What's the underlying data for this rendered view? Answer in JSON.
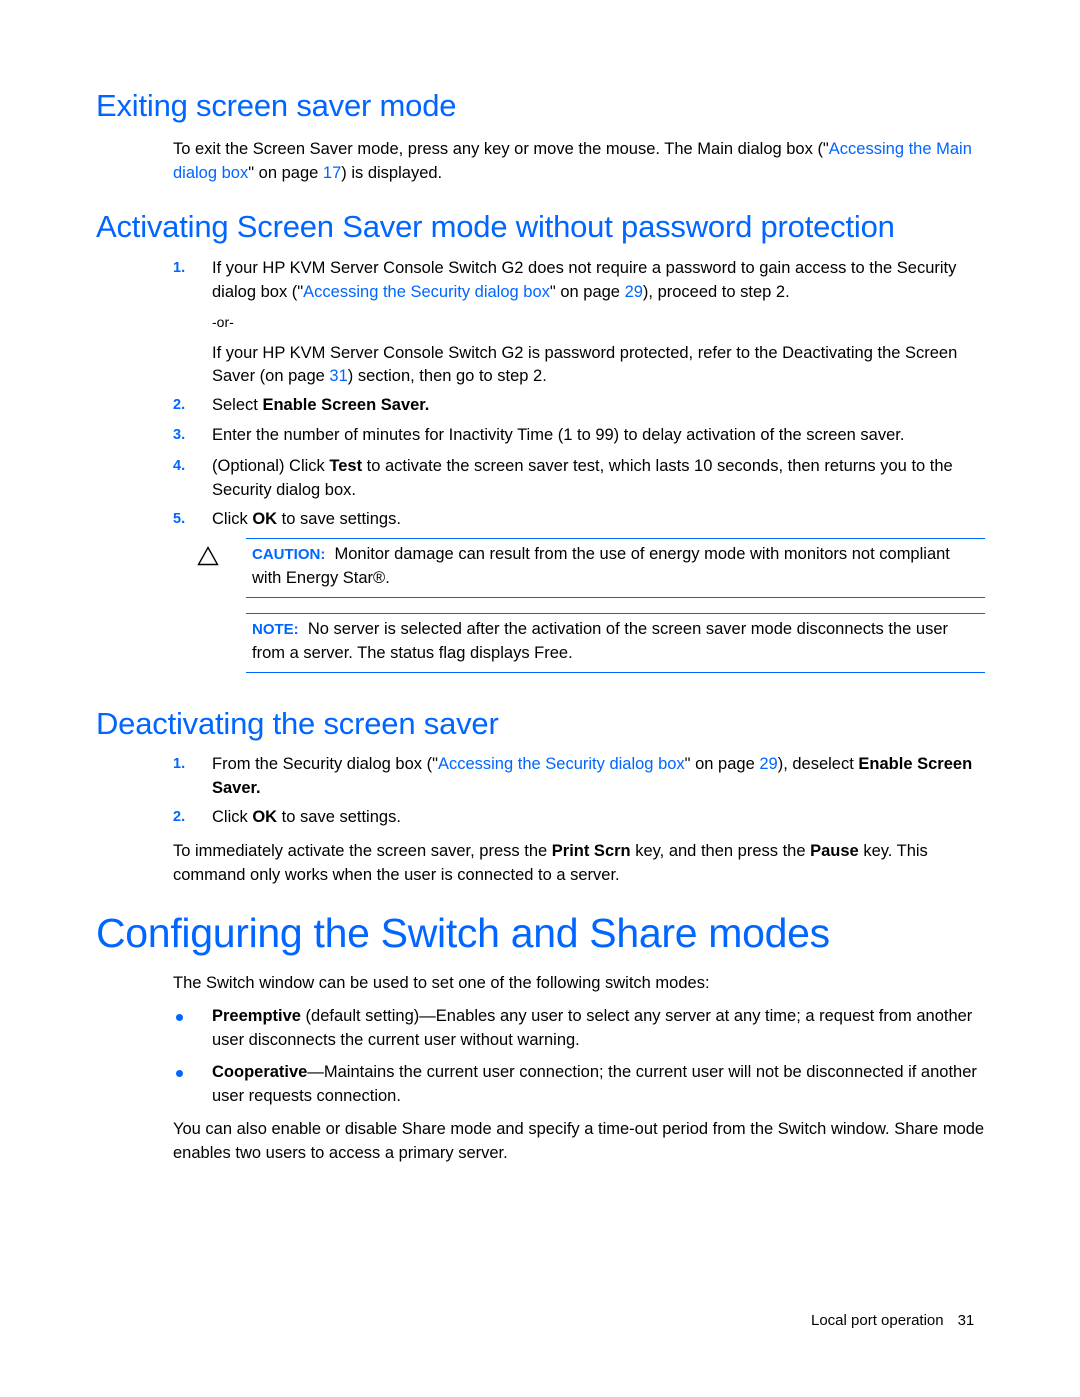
{
  "sections": {
    "exiting": {
      "heading": "Exiting screen saver mode",
      "para": {
        "t1": "To exit the Screen Saver mode, press any key or move the mouse. The Main dialog box (\"",
        "link1": "Accessing the Main dialog box",
        "t2": "\" on page ",
        "page": "17",
        "t3": ") is displayed."
      }
    },
    "activating": {
      "heading": "Activating Screen Saver mode without password protection",
      "steps": [
        {
          "num": "1.",
          "t1": "If your HP KVM Server Console Switch G2 does not require a password to gain access to the Security dialog box (\"",
          "link": "Accessing the Security dialog box",
          "t2": "\" on page ",
          "page": "29",
          "t3": "), proceed to step 2.",
          "or": "-or-",
          "alt_t1": "If your HP KVM Server Console Switch G2 is password protected, refer to the Deactivating the Screen Saver (on page ",
          "alt_page": "31",
          "alt_t2": ") section, then go to step 2."
        },
        {
          "num": "2.",
          "t1": "Select ",
          "bold": "Enable Screen Saver.",
          "t2": ""
        },
        {
          "num": "3.",
          "t1": "Enter the number of minutes for Inactivity Time (1 to 99) to delay activation of the screen saver."
        },
        {
          "num": "4.",
          "t1": "(Optional) Click ",
          "bold": "Test",
          "t2": " to activate the screen saver test, which lasts 10 seconds, then returns you to the Security dialog box."
        },
        {
          "num": "5.",
          "t1": "Click ",
          "bold": "OK",
          "t2": " to save settings."
        }
      ],
      "caution": {
        "label": "CAUTION:",
        "text": "Monitor damage can result from the use of energy mode with monitors not compliant with Energy Star®."
      },
      "note": {
        "label": "NOTE:",
        "text": "No server is selected after the activation of the screen saver mode disconnects the user from a server. The status flag displays Free."
      }
    },
    "deactivating": {
      "heading": "Deactivating the screen saver",
      "steps": [
        {
          "num": "1.",
          "t1": "From the Security dialog box (\"",
          "link": "Accessing the Security dialog box",
          "t2": "\" on page ",
          "page": "29",
          "t3": "), deselect ",
          "bold": "Enable Screen Saver."
        },
        {
          "num": "2.",
          "t1": "Click ",
          "bold": "OK",
          "t2": " to save settings."
        }
      ],
      "para": {
        "t1": "To immediately activate the screen saver, press the ",
        "b1": "Print Scrn",
        "t2": " key, and then press the ",
        "b2": "Pause",
        "t3": " key. This command only works when the user is connected to a server."
      }
    },
    "configuring": {
      "heading": "Configuring the Switch and Share modes",
      "intro": "The Switch window can be used to set one of the following switch modes:",
      "bullets": [
        {
          "bold": "Preemptive",
          "text": " (default setting)—Enables any user to select any server at any time; a request from another user disconnects the current user without warning."
        },
        {
          "bold": "Cooperative",
          "text": "—Maintains the current user connection; the current user will not be disconnected if another user requests connection."
        }
      ],
      "outro": "You can also enable or disable Share mode and specify a time-out period from the Switch window. Share mode enables two users to access a primary server."
    }
  },
  "footer": {
    "section": "Local port operation",
    "page": "31"
  },
  "colors": {
    "accent": "#0066ff",
    "text": "#000000"
  }
}
